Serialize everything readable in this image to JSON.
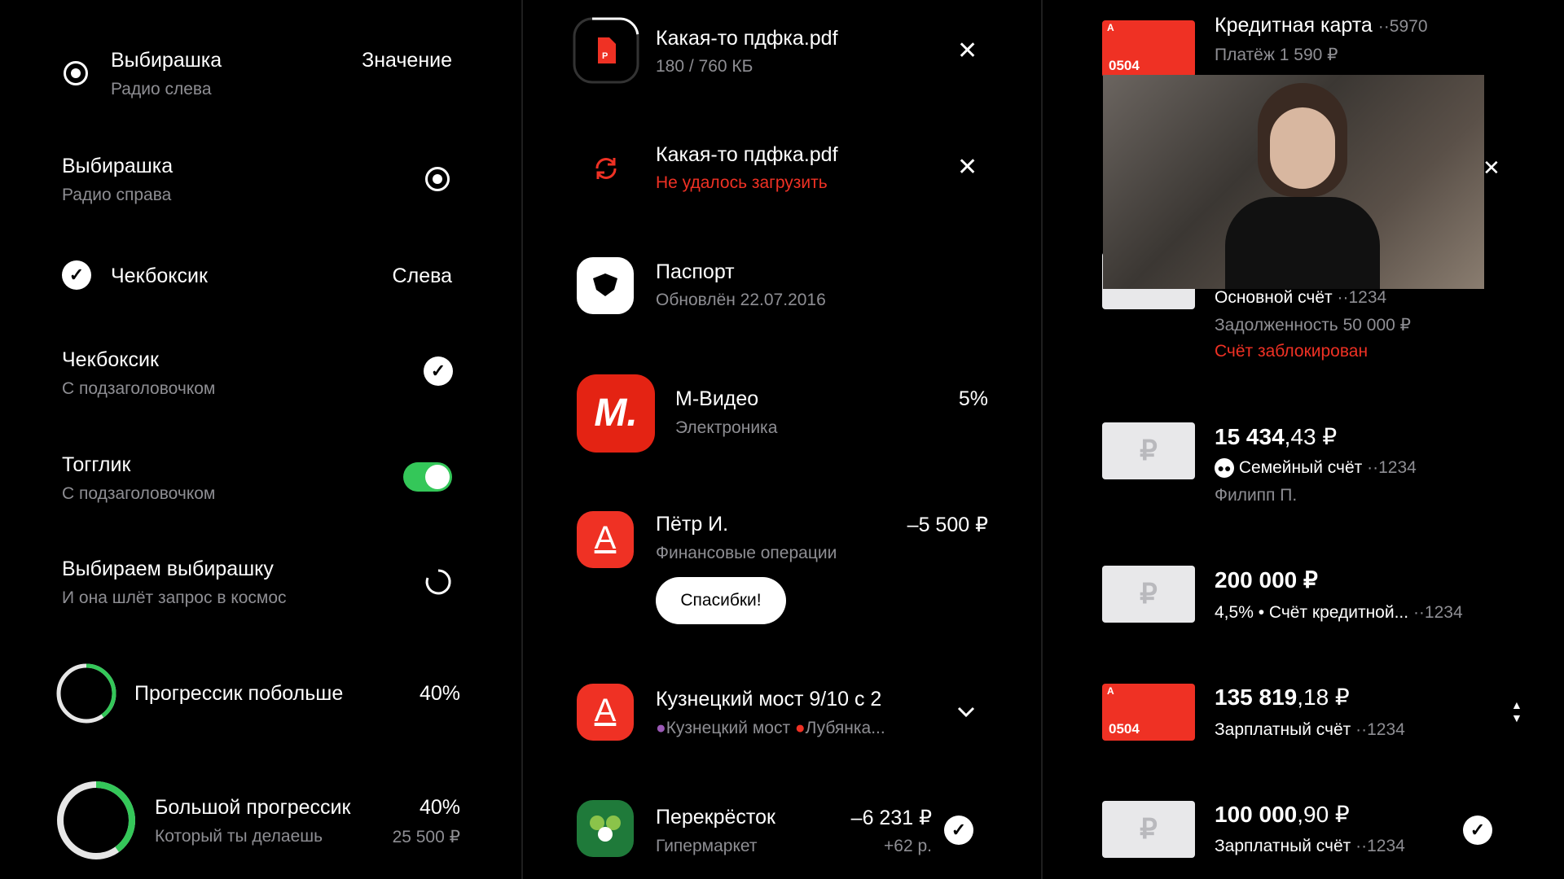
{
  "left": {
    "radio_left": {
      "title": "Выбирашка",
      "subtitle": "Радио слева",
      "value": "Значение"
    },
    "radio_right": {
      "title": "Выбирашка",
      "subtitle": "Радио справа"
    },
    "checkbox_left": {
      "title": "Чекбоксик",
      "value": "Слева"
    },
    "checkbox_right": {
      "title": "Чекбоксик",
      "subtitle": "С подзаголовочком"
    },
    "toggle": {
      "title": "Тогглик",
      "subtitle": "С подзаголовочком",
      "on": true
    },
    "loader": {
      "title": "Выбираем выбирашку",
      "subtitle": "И она шлёт запрос в космос"
    },
    "progress_small": {
      "title": "Прогрессик побольше",
      "value": "40%",
      "progress": 0.4
    },
    "progress_big": {
      "title": "Большой прогрессик",
      "subtitle": "Который ты делаешь",
      "value": "40%",
      "amount": "25 500 ₽",
      "progress": 0.4
    }
  },
  "middle": {
    "file1": {
      "name": "Какая-то пдфка.pdf",
      "size": "180 / 760 КБ",
      "icon": "pdf-icon",
      "progress": 0.24
    },
    "file2": {
      "name": "Какая-то пдфка.pdf",
      "error": "Не удалось загрузить",
      "icon": "retry-icon"
    },
    "passport": {
      "title": "Паспорт",
      "subtitle": "Обновлён 22.07.2016",
      "icon": "emblem-icon"
    },
    "mvideo": {
      "title": "М-Видео",
      "subtitle": "Электроника",
      "value": "5%",
      "logo": "М."
    },
    "petr": {
      "title": "Пётр И.",
      "subtitle": "Финансовые операции",
      "amount": "–5 500 ₽",
      "button": "Спасибки!",
      "logo": "А"
    },
    "kuznetsky": {
      "title": "Кузнецкий мост 9/10 с 2",
      "metro1": "Кузнецкий мост",
      "metro2": "Лубянка...",
      "logo": "А",
      "metro1_color": "#9b59b6",
      "metro2_color": "#ef3124"
    },
    "perekrestok": {
      "title": "Перекрёсток",
      "subtitle": "Гипермаркет",
      "amount": "–6 231 ₽",
      "cashback": "+62 р."
    }
  },
  "right": {
    "credit": {
      "title": "Кредитная карта",
      "suffix": "··5970",
      "subtitle": "Платёж 1 590 ₽",
      "card": "0504"
    },
    "main": {
      "title": "Основной счёт",
      "suffix": "··1234",
      "debt": "Задолженность 50 000 ₽",
      "blocked": "Счёт заблокирован"
    },
    "family": {
      "amount": "15 434",
      "cents": ",43 ₽",
      "title": "Семейный счёт",
      "suffix": "··1234",
      "owner": "Филипп П.",
      "card": "₽"
    },
    "creditacc": {
      "amount": "200 000 ₽",
      "title": "4,5% • Счёт кредитной...",
      "suffix": "··1234",
      "card": "₽"
    },
    "salary1": {
      "amount": "135 819",
      "cents": ",18 ₽",
      "title": "Зарплатный счёт",
      "suffix": "··1234",
      "card": "0504"
    },
    "salary2": {
      "amount": "100 000",
      "cents": ",90 ₽",
      "title": "Зарплатный счёт",
      "suffix": "··1234",
      "card": "₽"
    }
  },
  "video_overlay": {
    "description_icon": "video-call-icon"
  }
}
